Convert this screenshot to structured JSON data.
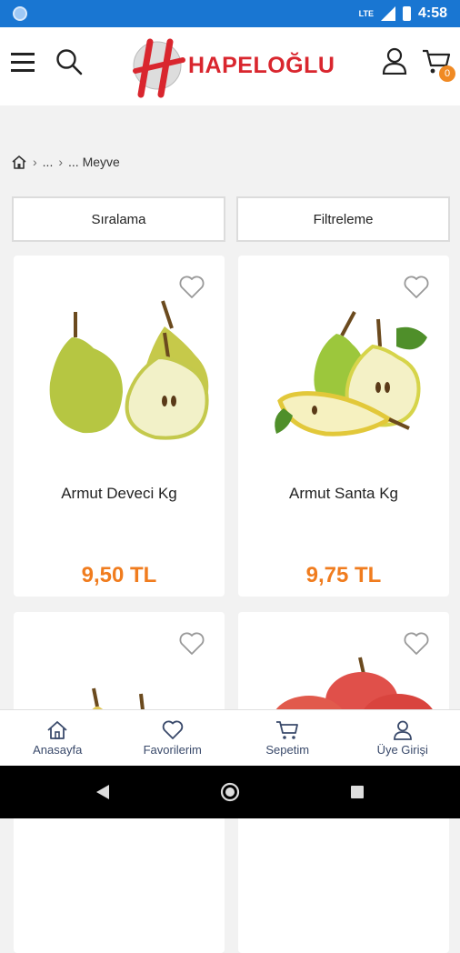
{
  "status_bar": {
    "time": "4:58",
    "network": "LTE"
  },
  "header": {
    "brand": "HAPELOĞLU",
    "cart_count": "0"
  },
  "breadcrumb": {
    "ellipsis1": "...",
    "ellipsis2": "...",
    "current": "Meyve"
  },
  "controls": {
    "sort_label": "Sıralama",
    "filter_label": "Filtreleme"
  },
  "products": [
    {
      "name": "Armut Deveci Kg",
      "price": "9,50 TL"
    },
    {
      "name": "Armut Santa Kg",
      "price": "9,75 TL"
    },
    {
      "name": "",
      "price": ""
    },
    {
      "name": "",
      "price": ""
    }
  ],
  "bottom_nav": [
    {
      "label": "Anasayfa",
      "icon": "home-icon"
    },
    {
      "label": "Favorilerim",
      "icon": "heart-icon"
    },
    {
      "label": "Sepetim",
      "icon": "cart-icon"
    },
    {
      "label": "Üye Girişi",
      "icon": "user-icon"
    }
  ],
  "colors": {
    "status_bar": "#1976d2",
    "brand_red": "#d9262e",
    "price_orange": "#f07c1e",
    "badge_orange": "#f08a24",
    "nav_text": "#3a4a6b"
  }
}
